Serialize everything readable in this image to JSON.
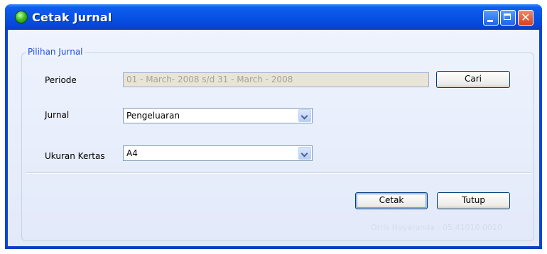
{
  "window": {
    "title": "Cetak Jurnal",
    "icon": "app-green-globe-icon",
    "accent": "#0852e6"
  },
  "group": {
    "legend": "Pilihan Jurnal"
  },
  "periode": {
    "label": "Periode",
    "value": "01 - March- 2008 s/d  31 - March - 2008",
    "search_button": "Cari"
  },
  "jurnal": {
    "label": "Jurnal",
    "selected": "Pengeluaran"
  },
  "ukuran": {
    "label": "Ukuran Kertas",
    "selected": "A4"
  },
  "actions": {
    "print": "Cetak",
    "close": "Tutup"
  },
  "footer": {
    "watermark": "Orris Hoyaranda - 05.41010.0010"
  }
}
